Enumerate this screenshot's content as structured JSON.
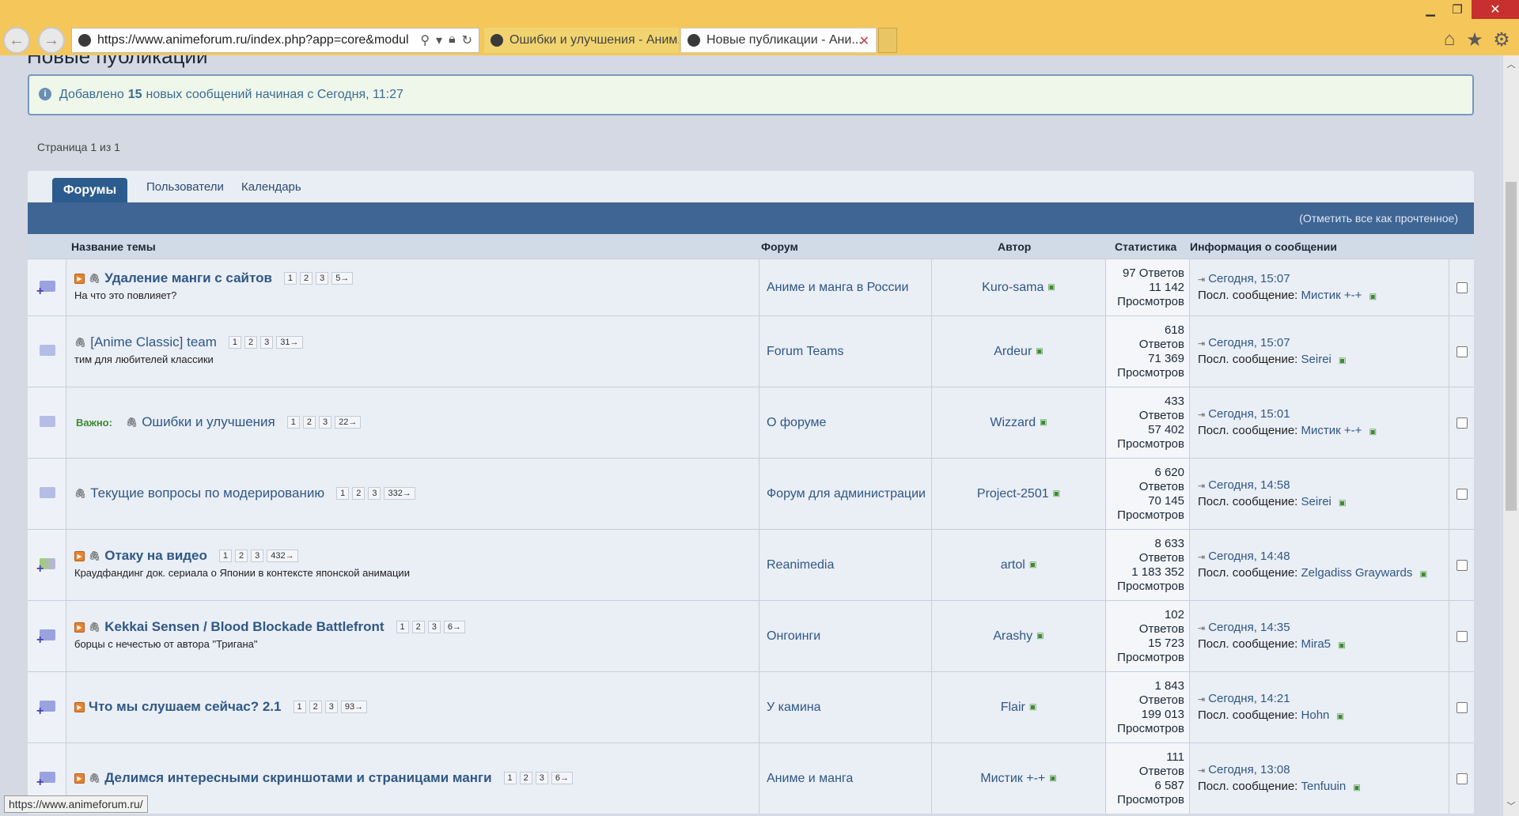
{
  "browser": {
    "url": "https://www.animeforum.ru/index.php?app=core&modul",
    "tabs": [
      {
        "title": "Ошибки и улучшения - Аним..."
      },
      {
        "title": "Новые публикации - Ани..."
      }
    ],
    "status_url": "https://www.animeforum.ru/"
  },
  "page": {
    "title": "Новые публикации",
    "notice": {
      "prefix": "Добавлено",
      "count": "15",
      "suffix": "новых сообщений начиная с Сегодня, 11:27"
    },
    "pagination": "Страница 1 из 1",
    "tabs": [
      "Форумы",
      "Пользователи",
      "Календарь"
    ],
    "mark_read": "(Отметить все как прочтенное)",
    "columns": {
      "topic": "Название темы",
      "forum": "Форум",
      "author": "Автор",
      "stats": "Статистика",
      "info": "Информация о сообщении"
    },
    "last_post_label": "Посл. сообщение:"
  },
  "rows": [
    {
      "title": "Удаление манги с сайтов",
      "desc": "На что это повлияет?",
      "pages": [
        "1",
        "2",
        "3",
        "5→"
      ],
      "forum": "Аниме и манга в России",
      "author": "Kuro-sama",
      "stats": [
        "97 Ответов",
        "11 142",
        "Просмотров"
      ],
      "time": "Сегодня, 15:07",
      "last_user": "Мистик +-+"
    },
    {
      "title": "[Anime Classic] team",
      "desc": "тим для любителей классики",
      "pages": [
        "1",
        "2",
        "3",
        "31→"
      ],
      "forum": "Forum Teams",
      "author": "Ardeur",
      "stats": [
        "618",
        "Ответов",
        "71 369",
        "Просмотров"
      ],
      "time": "Сегодня, 15:07",
      "last_user": "Seirei"
    },
    {
      "pinned_label": "Важно:",
      "title": "Ошибки и улучшения",
      "pages": [
        "1",
        "2",
        "3",
        "22→"
      ],
      "forum": "О форуме",
      "author": "Wizzard",
      "stats": [
        "433",
        "Ответов",
        "57 402",
        "Просмотров"
      ],
      "time": "Сегодня, 15:01",
      "last_user": "Мистик +-+"
    },
    {
      "title": "Текущие вопросы по модерированию",
      "pages": [
        "1",
        "2",
        "3",
        "332→"
      ],
      "forum": "Форум для администрации",
      "author": "Project-2501",
      "stats": [
        "6 620",
        "Ответов",
        "70 145",
        "Просмотров"
      ],
      "time": "Сегодня, 14:58",
      "last_user": "Seirei"
    },
    {
      "title": "Отаку на видео",
      "desc": "Краудфандинг док. сериала о Японии в контексте японской анимации",
      "pages": [
        "1",
        "2",
        "3",
        "432→"
      ],
      "forum": "Reanimedia",
      "author": "artol",
      "stats": [
        "8 633",
        "Ответов",
        "1 183 352",
        "Просмотров"
      ],
      "time": "Сегодня, 14:48",
      "last_user": "Zelgadiss Graywards"
    },
    {
      "title": "Kekkai Sensen / Blood Blockade Battlefront",
      "desc": "борцы с нечестью от автора \"Тригана\"",
      "pages": [
        "1",
        "2",
        "3",
        "6→"
      ],
      "forum": "Онгоинги",
      "author": "Arashy",
      "stats": [
        "102",
        "Ответов",
        "15 723",
        "Просмотров"
      ],
      "time": "Сегодня, 14:35",
      "last_user": "Mira5"
    },
    {
      "title": "Что мы слушаем сейчас? 2.1",
      "pages": [
        "1",
        "2",
        "3",
        "93→"
      ],
      "forum": "У камина",
      "author": "Flair",
      "stats": [
        "1 843",
        "Ответов",
        "199 013",
        "Просмотров"
      ],
      "time": "Сегодня, 14:21",
      "last_user": "Hohn"
    },
    {
      "title": "Делимся интересными скриншотами и страницами манги",
      "pages": [
        "1",
        "2",
        "3",
        "6→"
      ],
      "forum": "Аниме и манга",
      "author": "Мистик +-+",
      "stats": [
        "111",
        "Ответов",
        "6 587",
        "Просмотров"
      ],
      "time": "Сегодня, 13:08",
      "last_user": "Tenfuuin"
    }
  ]
}
